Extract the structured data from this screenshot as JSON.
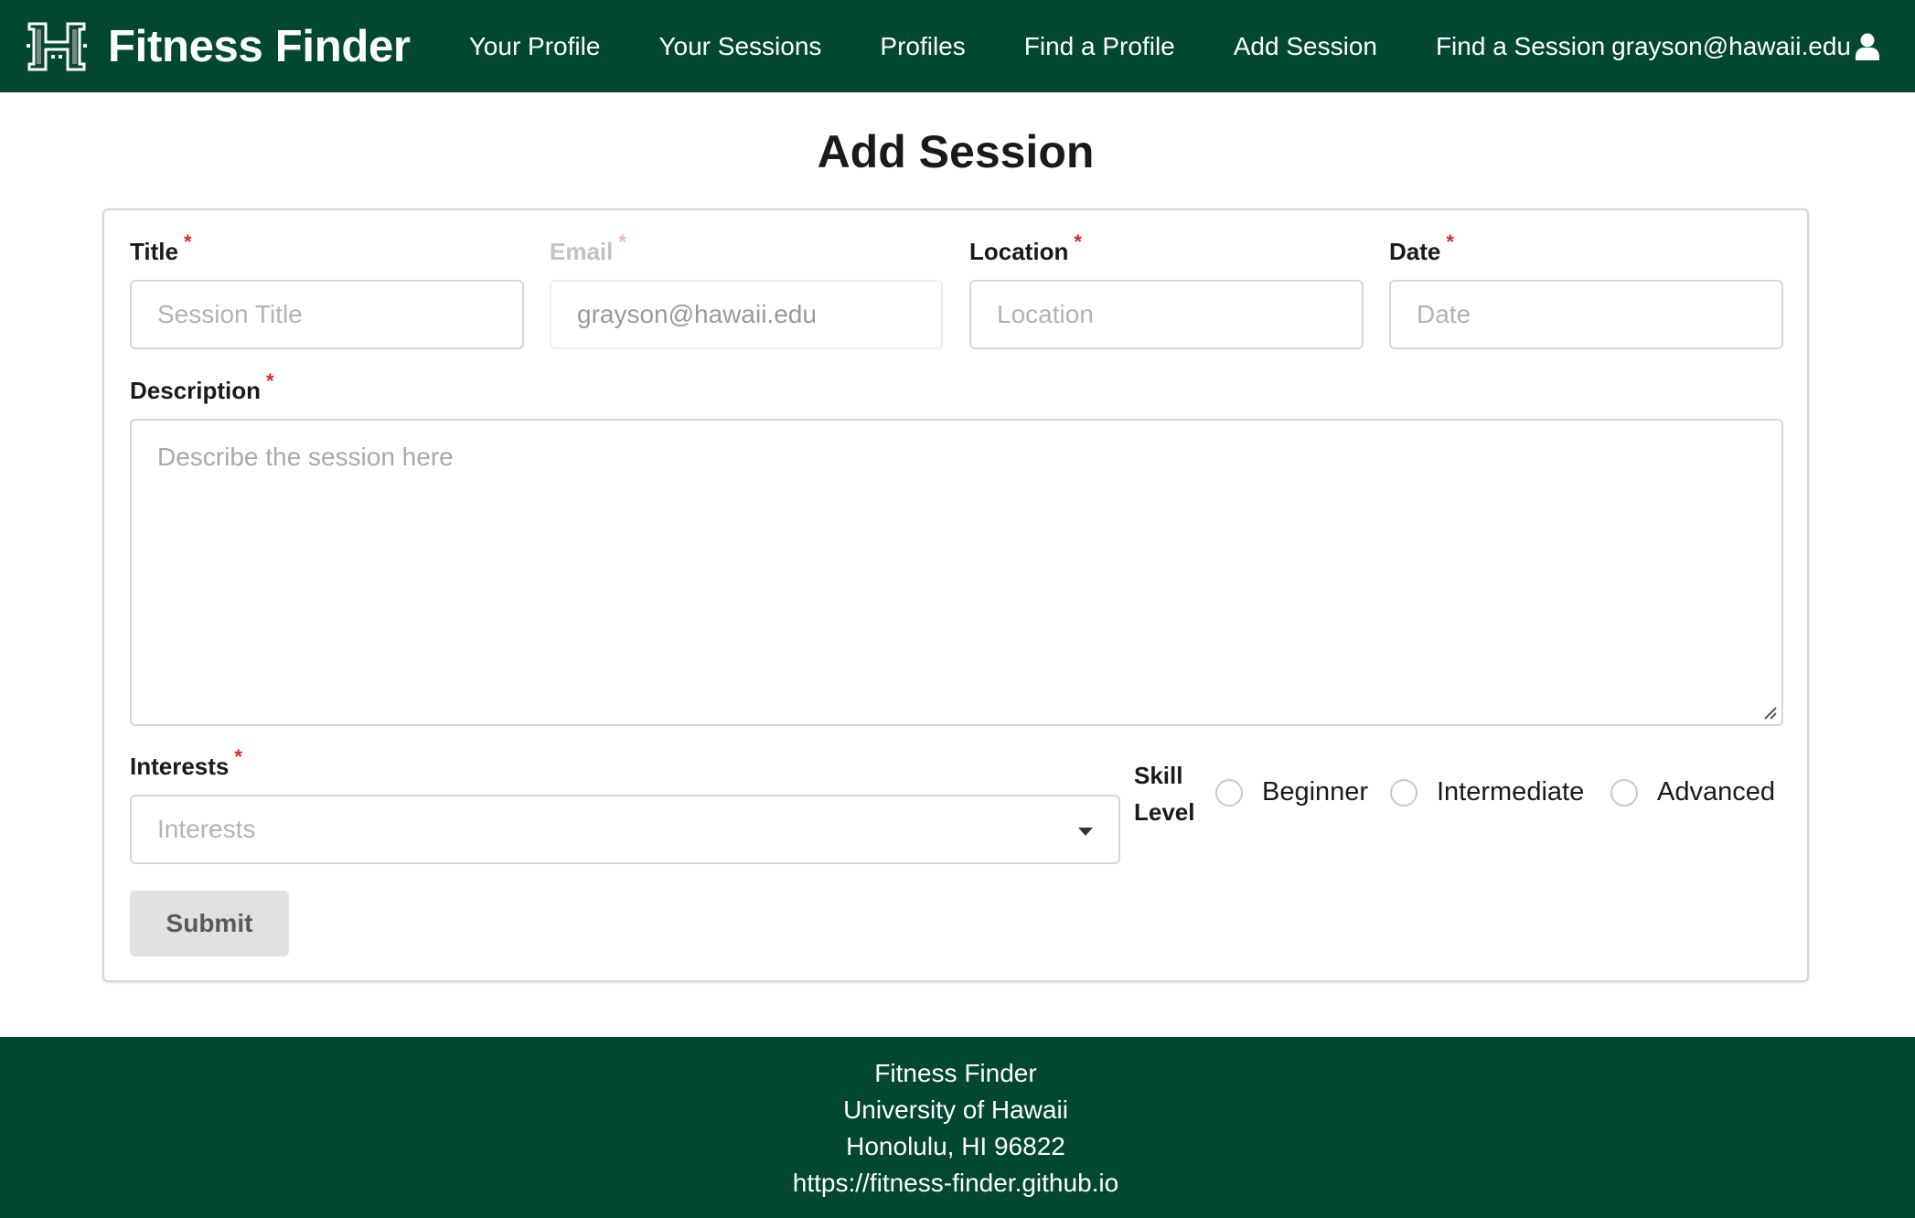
{
  "nav": {
    "brand": "Fitness Finder",
    "items": [
      "Your Profile",
      "Your Sessions",
      "Profiles",
      "Find a Profile",
      "Add Session",
      "Find a Session"
    ],
    "user": "grayson@hawaii.edu"
  },
  "page": {
    "title": "Add Session"
  },
  "form": {
    "title": {
      "label": "Title",
      "required": "*",
      "placeholder": "Session Title"
    },
    "email": {
      "label": "Email",
      "required": "*",
      "value": "grayson@hawaii.edu"
    },
    "location": {
      "label": "Location",
      "required": "*",
      "placeholder": "Location"
    },
    "date": {
      "label": "Date",
      "required": "*",
      "placeholder": "Date"
    },
    "description": {
      "label": "Description",
      "required": "*",
      "placeholder": "Describe the session here"
    },
    "interests": {
      "label": "Interests",
      "required": "*",
      "placeholder": "Interests"
    },
    "skill": {
      "label_line1": "Skill",
      "label_line2": "Level",
      "options": [
        "Beginner",
        "Intermediate",
        "Advanced"
      ]
    },
    "submit_label": "Submit"
  },
  "footer": {
    "lines": [
      "Fitness Finder",
      "University of Hawaii",
      "Honolulu, HI 96822",
      "https://fitness-finder.github.io"
    ]
  },
  "colors": {
    "primary": "#024731",
    "required": "#db2828",
    "button_bg": "#e0e1e2"
  },
  "icons": {
    "logo": "hawaii-h-logo-icon",
    "user": "user-icon",
    "dropdown": "caret-down-icon"
  }
}
